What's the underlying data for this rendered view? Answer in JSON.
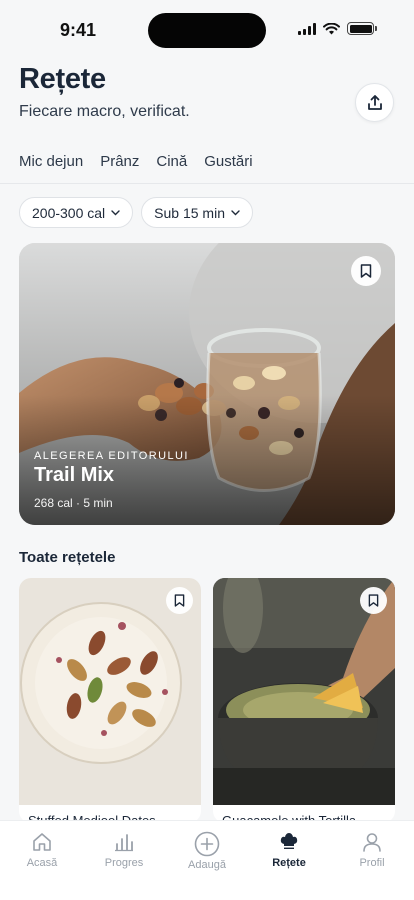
{
  "status": {
    "time": "9:41"
  },
  "header": {
    "title": "Rețete",
    "subtitle": "Fiecare macro, verificat."
  },
  "tabs": [
    {
      "label": "Mic dejun"
    },
    {
      "label": "Prânz"
    },
    {
      "label": "Cină"
    },
    {
      "label": "Gustări"
    }
  ],
  "filters": [
    {
      "label": "200-300 cal"
    },
    {
      "label": "Sub 15 min"
    }
  ],
  "featured": {
    "kicker": "ALEGEREA EDITORULUI",
    "title": "Trail Mix",
    "meta": "268 cal · 5 min"
  },
  "section": {
    "title": "Toate rețetele"
  },
  "cards": [
    {
      "title": "Stuffed Medjool Dates"
    },
    {
      "title": "Guacamole with Tortilla"
    }
  ],
  "nav": [
    {
      "label": "Acasă",
      "icon": "home-icon"
    },
    {
      "label": "Progres",
      "icon": "chart-icon"
    },
    {
      "label": "Adaugă",
      "icon": "plus-circle-icon"
    },
    {
      "label": "Rețete",
      "icon": "chef-hat-icon",
      "active": true
    },
    {
      "label": "Profil",
      "icon": "user-icon"
    }
  ]
}
